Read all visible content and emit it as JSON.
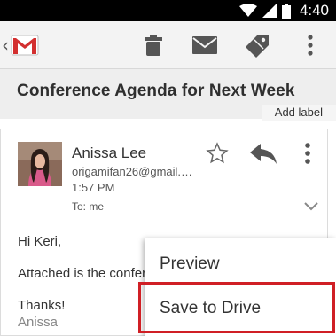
{
  "status_bar": {
    "time": "4:40",
    "icons": [
      "wifi-icon",
      "signal-icon",
      "battery-icon"
    ]
  },
  "action_bar": {
    "app_icon": "gmail-logo-icon",
    "actions": [
      "delete-icon",
      "mark-unread-icon",
      "label-icon",
      "more-vertical-icon"
    ]
  },
  "subject": {
    "title": "Conference Agenda for Next Week",
    "add_label": "Add label"
  },
  "message": {
    "sender_name": "Anissa Lee",
    "sender_email": "origamifan26@gmail.com",
    "time": "1:57 PM",
    "to": "To: me",
    "body_greeting": "Hi Keri,",
    "body_line1": "Attached is the confer",
    "body_thanks": "Thanks!",
    "body_signature": "Anissa"
  },
  "context_menu": {
    "items": [
      "Preview",
      "Save to Drive"
    ],
    "highlighted": "Save to Drive",
    "highlight_color": "#d01f25"
  },
  "colors": {
    "gmail_red": "#d32f2f",
    "toolbar_icon": "#555555"
  }
}
